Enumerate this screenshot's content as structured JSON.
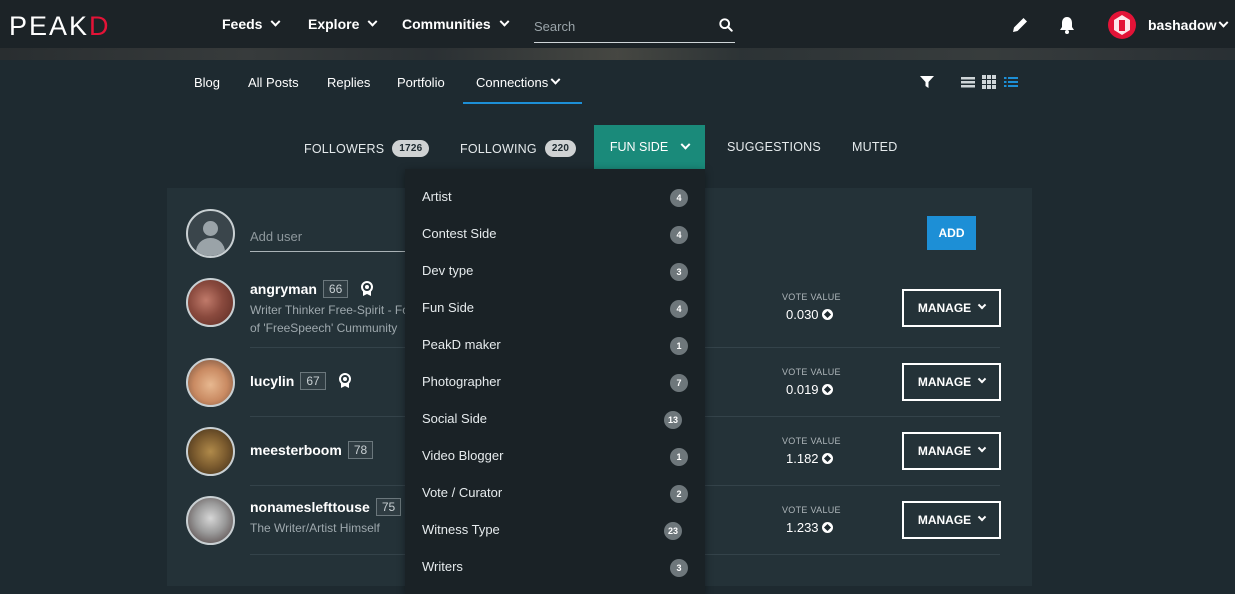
{
  "brand": {
    "logo_main": "PEAK",
    "logo_d": "D",
    "accent": "#e31337"
  },
  "topnav": {
    "feeds": "Feeds",
    "explore": "Explore",
    "communities": "Communities",
    "search_placeholder": "Search",
    "username": "bashadow"
  },
  "subnav": {
    "blog": "Blog",
    "all_posts": "All Posts",
    "replies": "Replies",
    "portfolio": "Portfolio",
    "connections": "Connections"
  },
  "tabs": {
    "followers": "FOLLOWERS",
    "followers_count": "1726",
    "following": "FOLLOWING",
    "following_count": "220",
    "fun_side": "FUN SIDE",
    "suggestions": "SUGGESTIONS",
    "muted": "MUTED"
  },
  "add_user": {
    "placeholder": "Add user",
    "button": "ADD"
  },
  "users": [
    {
      "name": "angryman",
      "rep": "66",
      "bio1": "Writer Thinker Free-Spirit - Fo",
      "bio2": "of 'FreeSpeech' Cummunity",
      "vote_label": "VOTE VALUE",
      "vote_value": "0.030",
      "manage": "MANAGE"
    },
    {
      "name": "lucylin",
      "rep": "67",
      "bio1": "",
      "bio2": "",
      "vote_label": "VOTE VALUE",
      "vote_value": "0.019",
      "manage": "MANAGE"
    },
    {
      "name": "meesterboom",
      "rep": "78",
      "bio1": "",
      "bio2": "",
      "vote_label": "VOTE VALUE",
      "vote_value": "1.182",
      "manage": "MANAGE"
    },
    {
      "name": "nonamesleftto use",
      "rep": "75",
      "bio1": "The Writer/Artist Himself",
      "bio2": "",
      "vote_label": "VOTE VALUE",
      "vote_value": "1.233",
      "manage": "MANAGE"
    }
  ],
  "dropdown": [
    {
      "label": "Artist",
      "count": "4"
    },
    {
      "label": "Contest Side",
      "count": "4"
    },
    {
      "label": "Dev type",
      "count": "3"
    },
    {
      "label": "Fun Side",
      "count": "4"
    },
    {
      "label": "PeakD maker",
      "count": "1"
    },
    {
      "label": "Photographer",
      "count": "7"
    },
    {
      "label": "Social Side",
      "count": "13"
    },
    {
      "label": "Video Blogger",
      "count": "1"
    },
    {
      "label": "Vote / Curator",
      "count": "2"
    },
    {
      "label": "Witness Type",
      "count": "23"
    },
    {
      "label": "Writers",
      "count": "3"
    }
  ]
}
